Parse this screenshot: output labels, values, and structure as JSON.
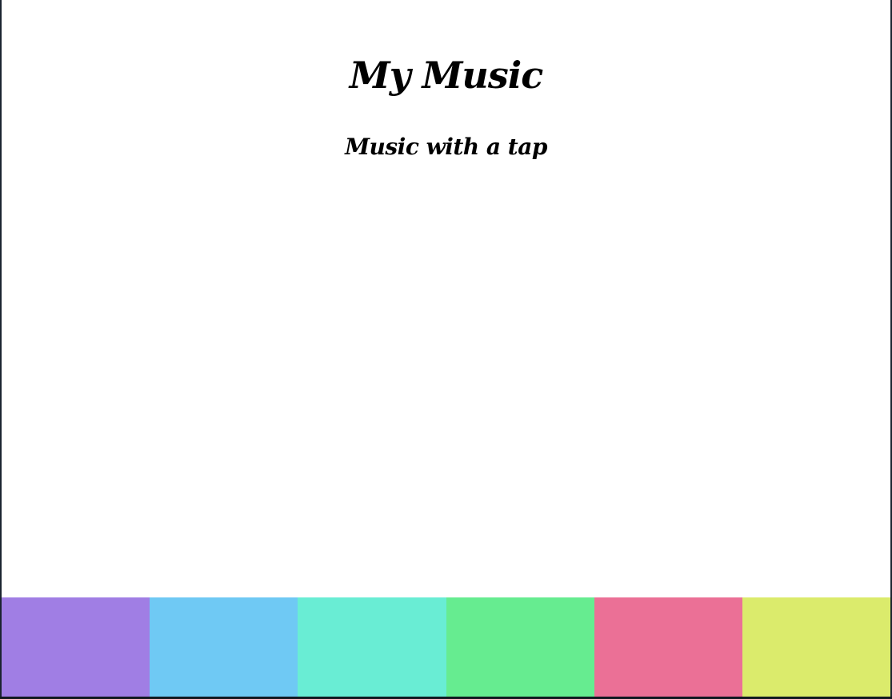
{
  "header": {
    "title": "My Music",
    "subtitle": "Music with a tap"
  },
  "pads": [
    {
      "name": "pad-1",
      "color": "#a07ee4"
    },
    {
      "name": "pad-2",
      "color": "#6fc9f4"
    },
    {
      "name": "pad-3",
      "color": "#69edd4"
    },
    {
      "name": "pad-4",
      "color": "#66ec90"
    },
    {
      "name": "pad-5",
      "color": "#eb7096"
    },
    {
      "name": "pad-6",
      "color": "#dbeb6c"
    }
  ]
}
